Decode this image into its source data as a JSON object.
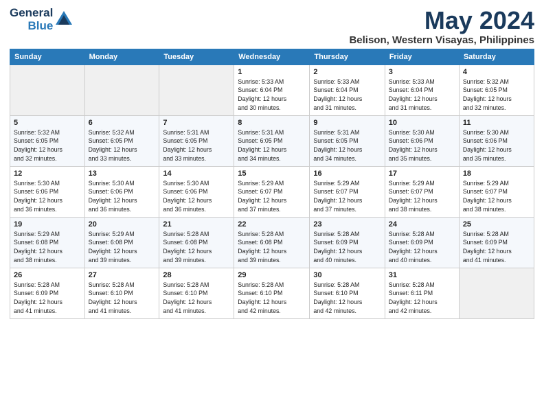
{
  "logo": {
    "line1": "General",
    "line2": "Blue"
  },
  "title": "May 2024",
  "location": "Belison, Western Visayas, Philippines",
  "days_of_week": [
    "Sunday",
    "Monday",
    "Tuesday",
    "Wednesday",
    "Thursday",
    "Friday",
    "Saturday"
  ],
  "weeks": [
    [
      {
        "day": "",
        "info": ""
      },
      {
        "day": "",
        "info": ""
      },
      {
        "day": "",
        "info": ""
      },
      {
        "day": "1",
        "info": "Sunrise: 5:33 AM\nSunset: 6:04 PM\nDaylight: 12 hours\nand 30 minutes."
      },
      {
        "day": "2",
        "info": "Sunrise: 5:33 AM\nSunset: 6:04 PM\nDaylight: 12 hours\nand 31 minutes."
      },
      {
        "day": "3",
        "info": "Sunrise: 5:33 AM\nSunset: 6:04 PM\nDaylight: 12 hours\nand 31 minutes."
      },
      {
        "day": "4",
        "info": "Sunrise: 5:32 AM\nSunset: 6:05 PM\nDaylight: 12 hours\nand 32 minutes."
      }
    ],
    [
      {
        "day": "5",
        "info": "Sunrise: 5:32 AM\nSunset: 6:05 PM\nDaylight: 12 hours\nand 32 minutes."
      },
      {
        "day": "6",
        "info": "Sunrise: 5:32 AM\nSunset: 6:05 PM\nDaylight: 12 hours\nand 33 minutes."
      },
      {
        "day": "7",
        "info": "Sunrise: 5:31 AM\nSunset: 6:05 PM\nDaylight: 12 hours\nand 33 minutes."
      },
      {
        "day": "8",
        "info": "Sunrise: 5:31 AM\nSunset: 6:05 PM\nDaylight: 12 hours\nand 34 minutes."
      },
      {
        "day": "9",
        "info": "Sunrise: 5:31 AM\nSunset: 6:05 PM\nDaylight: 12 hours\nand 34 minutes."
      },
      {
        "day": "10",
        "info": "Sunrise: 5:30 AM\nSunset: 6:06 PM\nDaylight: 12 hours\nand 35 minutes."
      },
      {
        "day": "11",
        "info": "Sunrise: 5:30 AM\nSunset: 6:06 PM\nDaylight: 12 hours\nand 35 minutes."
      }
    ],
    [
      {
        "day": "12",
        "info": "Sunrise: 5:30 AM\nSunset: 6:06 PM\nDaylight: 12 hours\nand 36 minutes."
      },
      {
        "day": "13",
        "info": "Sunrise: 5:30 AM\nSunset: 6:06 PM\nDaylight: 12 hours\nand 36 minutes."
      },
      {
        "day": "14",
        "info": "Sunrise: 5:30 AM\nSunset: 6:06 PM\nDaylight: 12 hours\nand 36 minutes."
      },
      {
        "day": "15",
        "info": "Sunrise: 5:29 AM\nSunset: 6:07 PM\nDaylight: 12 hours\nand 37 minutes."
      },
      {
        "day": "16",
        "info": "Sunrise: 5:29 AM\nSunset: 6:07 PM\nDaylight: 12 hours\nand 37 minutes."
      },
      {
        "day": "17",
        "info": "Sunrise: 5:29 AM\nSunset: 6:07 PM\nDaylight: 12 hours\nand 38 minutes."
      },
      {
        "day": "18",
        "info": "Sunrise: 5:29 AM\nSunset: 6:07 PM\nDaylight: 12 hours\nand 38 minutes."
      }
    ],
    [
      {
        "day": "19",
        "info": "Sunrise: 5:29 AM\nSunset: 6:08 PM\nDaylight: 12 hours\nand 38 minutes."
      },
      {
        "day": "20",
        "info": "Sunrise: 5:29 AM\nSunset: 6:08 PM\nDaylight: 12 hours\nand 39 minutes."
      },
      {
        "day": "21",
        "info": "Sunrise: 5:28 AM\nSunset: 6:08 PM\nDaylight: 12 hours\nand 39 minutes."
      },
      {
        "day": "22",
        "info": "Sunrise: 5:28 AM\nSunset: 6:08 PM\nDaylight: 12 hours\nand 39 minutes."
      },
      {
        "day": "23",
        "info": "Sunrise: 5:28 AM\nSunset: 6:09 PM\nDaylight: 12 hours\nand 40 minutes."
      },
      {
        "day": "24",
        "info": "Sunrise: 5:28 AM\nSunset: 6:09 PM\nDaylight: 12 hours\nand 40 minutes."
      },
      {
        "day": "25",
        "info": "Sunrise: 5:28 AM\nSunset: 6:09 PM\nDaylight: 12 hours\nand 41 minutes."
      }
    ],
    [
      {
        "day": "26",
        "info": "Sunrise: 5:28 AM\nSunset: 6:09 PM\nDaylight: 12 hours\nand 41 minutes."
      },
      {
        "day": "27",
        "info": "Sunrise: 5:28 AM\nSunset: 6:10 PM\nDaylight: 12 hours\nand 41 minutes."
      },
      {
        "day": "28",
        "info": "Sunrise: 5:28 AM\nSunset: 6:10 PM\nDaylight: 12 hours\nand 41 minutes."
      },
      {
        "day": "29",
        "info": "Sunrise: 5:28 AM\nSunset: 6:10 PM\nDaylight: 12 hours\nand 42 minutes."
      },
      {
        "day": "30",
        "info": "Sunrise: 5:28 AM\nSunset: 6:10 PM\nDaylight: 12 hours\nand 42 minutes."
      },
      {
        "day": "31",
        "info": "Sunrise: 5:28 AM\nSunset: 6:11 PM\nDaylight: 12 hours\nand 42 minutes."
      },
      {
        "day": "",
        "info": ""
      }
    ]
  ]
}
